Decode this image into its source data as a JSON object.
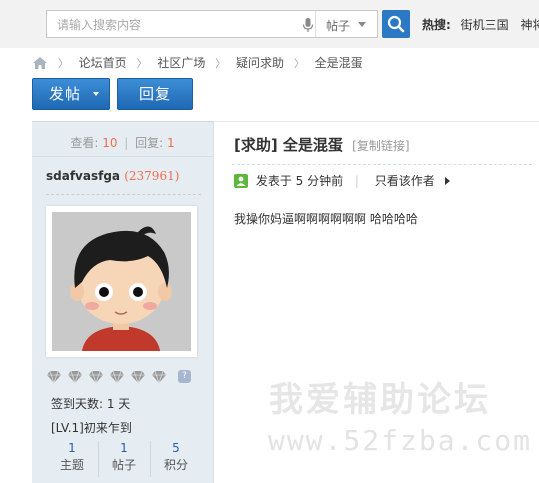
{
  "search": {
    "placeholder": "请输入搜索内容",
    "type_label": "帖子",
    "hot_label": "热搜:",
    "hot_links": [
      "街机三国",
      "神将"
    ]
  },
  "breadcrumb": [
    "论坛首页",
    "社区广场",
    "疑问求助",
    "全是混蛋"
  ],
  "buttons": {
    "post": "发帖",
    "reply": "回复"
  },
  "sidebar": {
    "views_label": "查看:",
    "views": "10",
    "replies_label": "回复:",
    "replies": "1",
    "username": "sdafvasfga",
    "uid": "(237961)",
    "signin": "签到天数: 1 天",
    "level": "[LV.1]初来乍到",
    "counts": [
      {
        "value": "1",
        "label": "主题"
      },
      {
        "value": "1",
        "label": "帖子"
      },
      {
        "value": "5",
        "label": "积分"
      }
    ]
  },
  "post": {
    "title": "[求助] 全是混蛋",
    "copy_link": "[复制链接]",
    "posted": "发表于 5 分钟前",
    "only_author": "只看该作者",
    "content": "我操你妈逼啊啊啊啊啊啊 哈哈哈哈"
  },
  "watermark": {
    "line1": "我爱辅助论坛",
    "line2": "www.52fzba.com"
  },
  "colors": {
    "accent": "#2b78c5",
    "highlight": "#f26c4f",
    "sidebar_bg": "#e5edf2"
  }
}
